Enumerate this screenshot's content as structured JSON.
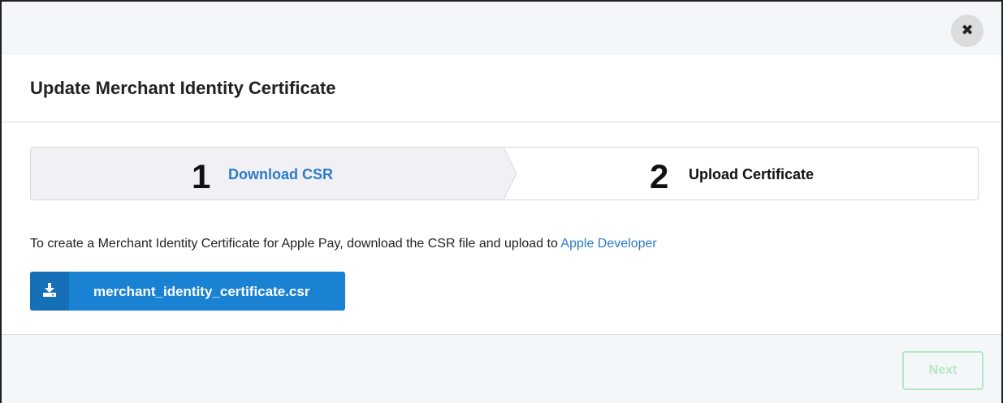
{
  "dialog": {
    "title": "Update Merchant Identity Certificate",
    "close_icon": "close-icon",
    "close_glyph": "✖"
  },
  "stepper": {
    "steps": [
      {
        "number": "1",
        "label": "Download CSR",
        "state": "active"
      },
      {
        "number": "2",
        "label": "Upload Certificate",
        "state": "inactive"
      }
    ]
  },
  "description": {
    "text": "To create a Merchant Identity Certificate for Apple Pay, download the CSR file and upload to ",
    "link_text": "Apple Developer"
  },
  "download_button": {
    "label": "merchant_identity_certificate.csr",
    "icon": "download-icon"
  },
  "footer": {
    "next_label": "Next",
    "next_disabled": true
  },
  "colors": {
    "accent": "#1a82d2",
    "link": "#2a7bc8",
    "next_disabled": "#b6e6c6",
    "header_bg": "#f3f7fa"
  }
}
